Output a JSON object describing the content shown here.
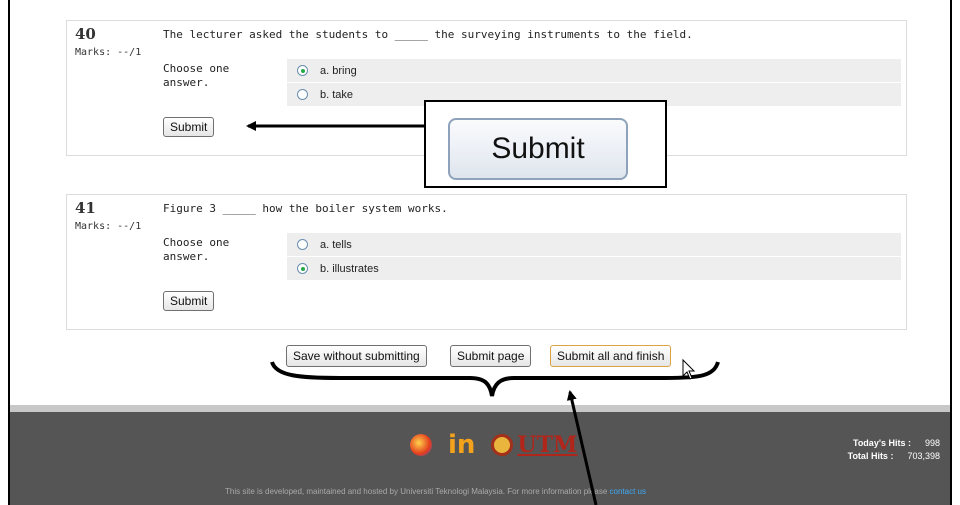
{
  "questions": [
    {
      "number": "40",
      "marks": "Marks: --/1",
      "text": "The lecturer asked the students to _____ the surveying instruments to the field.",
      "prompt": "Choose one answer.",
      "options": [
        {
          "label": "a. bring",
          "selected": true
        },
        {
          "label": "b. take",
          "selected": false
        }
      ],
      "submit_label": "Submit"
    },
    {
      "number": "41",
      "marks": "Marks: --/1",
      "text": "Figure 3 _____ how the boiler system works.",
      "prompt": "Choose one answer.",
      "options": [
        {
          "label": "a. tells",
          "selected": false
        },
        {
          "label": "b. illustrates",
          "selected": true
        }
      ],
      "submit_label": "Submit"
    }
  ],
  "callout": {
    "label": "Submit"
  },
  "navigation": {
    "save_label": "Save without submitting",
    "submit_page_label": "Submit page",
    "submit_all_label": "Submit all and finish"
  },
  "footer": {
    "logo_text": "UTM",
    "logo_mark": "in",
    "todays_hits_label": "Today's Hits :",
    "todays_hits_value": "998",
    "total_hits_label": "Total Hits :",
    "total_hits_value": "703,398",
    "note": "This site is developed, maintained and hosted by Universiti Teknologi Malaysia. For more information please",
    "contact_label": "contact us"
  },
  "colors": {
    "footer_bg": "#555555",
    "radio_selected": "#27a84a",
    "contact_link": "#3fa9f5"
  }
}
